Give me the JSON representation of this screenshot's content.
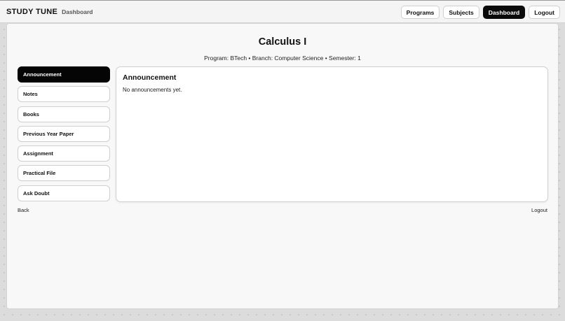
{
  "header": {
    "brand": "STUDY TUNE",
    "subtitle": "Dashboard",
    "nav": [
      {
        "label": "Programs",
        "active": false
      },
      {
        "label": "Subjects",
        "active": false
      },
      {
        "label": "Dashboard",
        "active": true
      },
      {
        "label": "Logout",
        "active": false
      }
    ]
  },
  "subject": {
    "title": "Calculus I",
    "meta": "Program: BTech • Branch: Computer Science • Semester: 1"
  },
  "sidebar": {
    "active_index": 0,
    "items": [
      {
        "label": "Announcement"
      },
      {
        "label": "Notes"
      },
      {
        "label": "Books"
      },
      {
        "label": "Previous Year Paper"
      },
      {
        "label": "Assignment"
      },
      {
        "label": "Practical File"
      },
      {
        "label": "Ask Doubt"
      }
    ]
  },
  "panel": {
    "title": "Announcement",
    "text": "No announcements yet."
  },
  "footer": {
    "back_label": "Back",
    "logout_label": "Logout"
  }
}
